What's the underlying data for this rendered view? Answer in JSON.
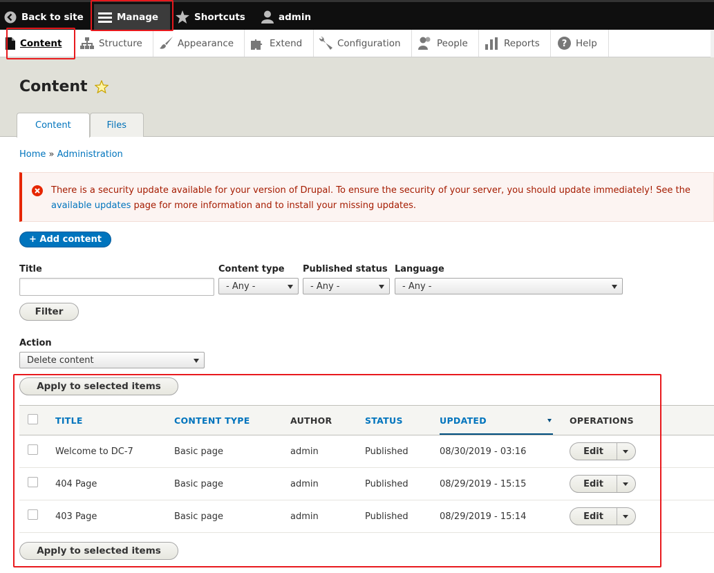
{
  "toolbar": {
    "back_label": "Back to site",
    "manage_label": "Manage",
    "shortcuts_label": "Shortcuts",
    "user_label": "admin"
  },
  "tray": {
    "items": [
      {
        "label": "Content",
        "icon": "file-icon"
      },
      {
        "label": "Structure",
        "icon": "sitemap-icon"
      },
      {
        "label": "Appearance",
        "icon": "paintbrush-icon"
      },
      {
        "label": "Extend",
        "icon": "puzzle-icon"
      },
      {
        "label": "Configuration",
        "icon": "wrench-icon"
      },
      {
        "label": "People",
        "icon": "people-icon"
      },
      {
        "label": "Reports",
        "icon": "bar-chart-icon"
      },
      {
        "label": "Help",
        "icon": "help-icon"
      }
    ]
  },
  "page": {
    "title": "Content",
    "tabs": [
      {
        "label": "Content"
      },
      {
        "label": "Files"
      }
    ]
  },
  "breadcrumb": {
    "home": "Home",
    "separator": "»",
    "admin": "Administration"
  },
  "message": {
    "text_before": "There is a security update available for your version of Drupal. To ensure the security of your server, you should update immediately! See the",
    "link": "available updates",
    "text_after": "page for more information and to install your missing updates."
  },
  "add_content_label": "+ Add content",
  "filters": {
    "title_label": "Title",
    "title_value": "",
    "type_label": "Content type",
    "type_value": "- Any -",
    "status_label": "Published status",
    "status_value": "- Any -",
    "language_label": "Language",
    "language_value": "- Any -",
    "filter_button": "Filter"
  },
  "action": {
    "label": "Action",
    "value": "Delete content",
    "apply_label": "Apply to selected items"
  },
  "table": {
    "headers": {
      "title": "TITLE",
      "type": "CONTENT TYPE",
      "author": "AUTHOR",
      "status": "STATUS",
      "updated": "UPDATED",
      "operations": "OPERATIONS"
    },
    "rows": [
      {
        "title": "Welcome to DC-7",
        "type": "Basic page",
        "author": "admin",
        "status": "Published",
        "updated": "08/30/2019 - 03:16",
        "op": "Edit"
      },
      {
        "title": "404 Page",
        "type": "Basic page",
        "author": "admin",
        "status": "Published",
        "updated": "08/29/2019 - 15:15",
        "op": "Edit"
      },
      {
        "title": "403 Page",
        "type": "Basic page",
        "author": "admin",
        "status": "Published",
        "updated": "08/29/2019 - 15:14",
        "op": "Edit"
      }
    ]
  },
  "colors": {
    "link": "#0074bd",
    "highlight": "#e8191d",
    "error": "#e62600",
    "toolbar": "#0f0f0f"
  }
}
